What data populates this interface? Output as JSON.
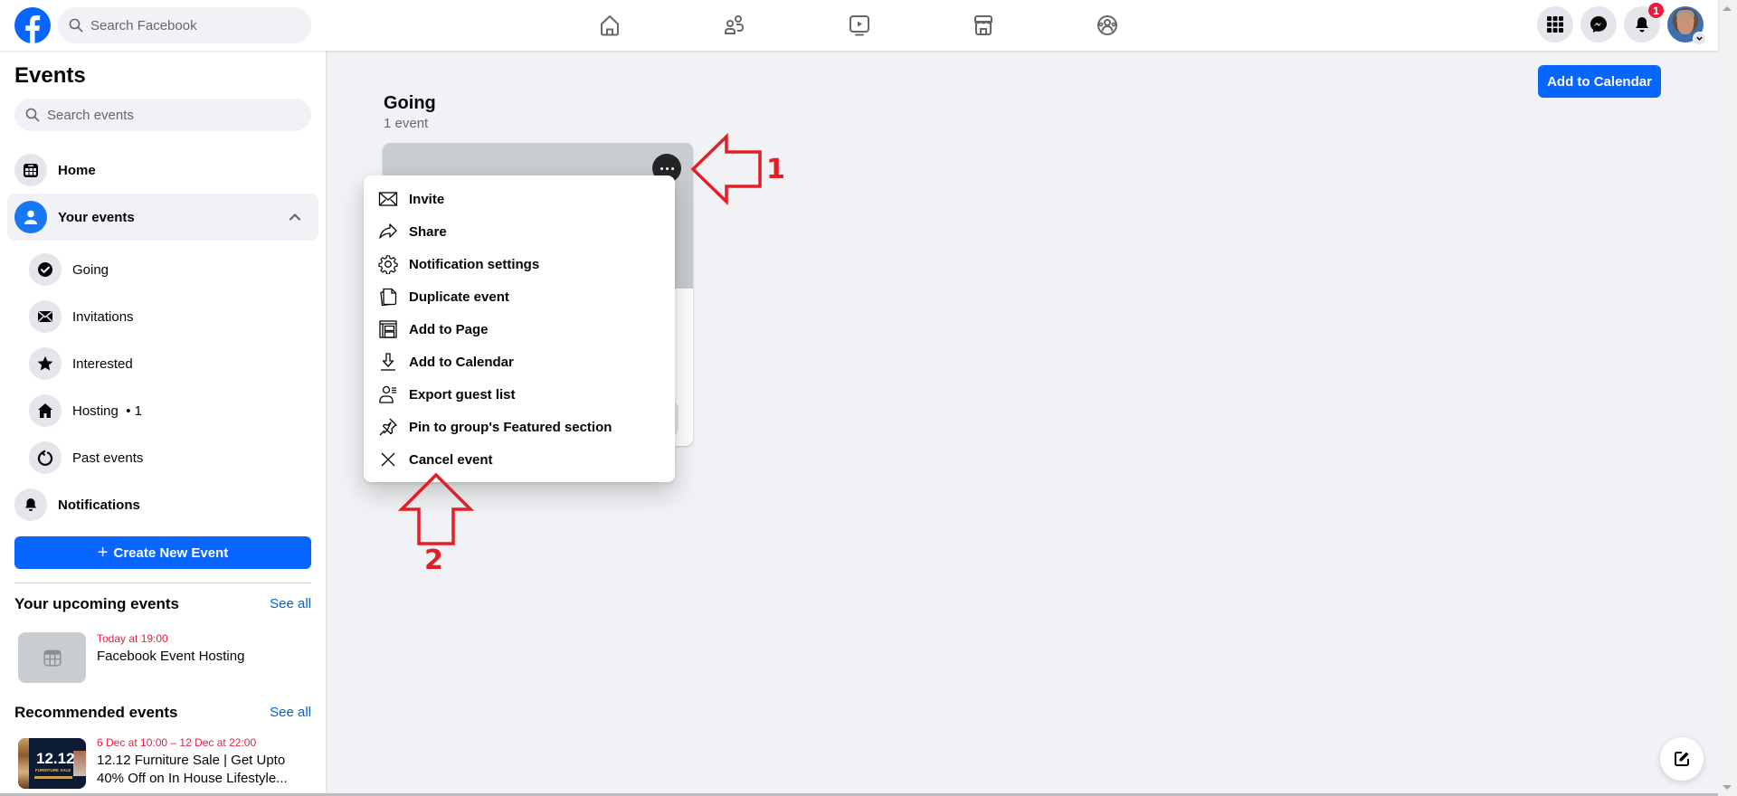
{
  "header": {
    "search_placeholder": "Search Facebook",
    "nav": [
      {
        "name": "home",
        "icon": "home-icon"
      },
      {
        "name": "friends",
        "icon": "friends-icon"
      },
      {
        "name": "video",
        "icon": "video-icon"
      },
      {
        "name": "marketplace",
        "icon": "marketplace-icon"
      },
      {
        "name": "groups",
        "icon": "groups-icon"
      }
    ],
    "notification_count": "1",
    "brand_color": "#0866ff"
  },
  "sidebar": {
    "title": "Events",
    "search_placeholder": "Search events",
    "items": [
      {
        "label": "Home",
        "icon": "calendar-grid-icon"
      },
      {
        "label": "Your events",
        "icon": "person-icon",
        "expanded": true
      }
    ],
    "sub_items": [
      {
        "label": "Going",
        "icon": "check-circle-icon"
      },
      {
        "label": "Invitations",
        "icon": "envelope-icon"
      },
      {
        "label": "Interested",
        "icon": "star-icon"
      },
      {
        "label": "Hosting  • 1",
        "icon": "house-icon"
      },
      {
        "label": "Past events",
        "icon": "history-icon"
      }
    ],
    "notifications_label": "Notifications",
    "create_button": "Create New Event",
    "upcoming": {
      "title": "Your upcoming events",
      "see_all": "See all",
      "events": [
        {
          "date": "Today at 19:00",
          "name": "Facebook Event Hosting"
        }
      ]
    },
    "recommended": {
      "title": "Recommended events",
      "see_all": "See all",
      "events": [
        {
          "date": "6 Dec at 10:00 – 12 Dec at 22:00",
          "name": "12.12 Furniture Sale | Get Upto 40% Off on In House Lifestyle...",
          "thumb_text": "12.12",
          "thumb_sub": "FURNITURE SALE"
        }
      ]
    }
  },
  "main": {
    "add_to_calendar": "Add to Calendar",
    "section_title": "Going",
    "section_count": "1 event"
  },
  "menu": {
    "items": [
      {
        "label": "Invite",
        "icon": "envelope-outline-icon"
      },
      {
        "label": "Share",
        "icon": "share-arrow-icon"
      },
      {
        "label": "Notification settings",
        "icon": "gear-icon"
      },
      {
        "label": "Duplicate event",
        "icon": "duplicate-icon"
      },
      {
        "label": "Add to Page",
        "icon": "page-icon"
      },
      {
        "label": "Add to Calendar",
        "icon": "download-icon"
      },
      {
        "label": "Export guest list",
        "icon": "guest-list-icon"
      },
      {
        "label": "Pin to group's Featured section",
        "icon": "pin-icon"
      },
      {
        "label": "Cancel event",
        "icon": "close-icon"
      }
    ]
  },
  "annotations": {
    "step1": "1",
    "step2": "2",
    "color": "#e41e25"
  }
}
